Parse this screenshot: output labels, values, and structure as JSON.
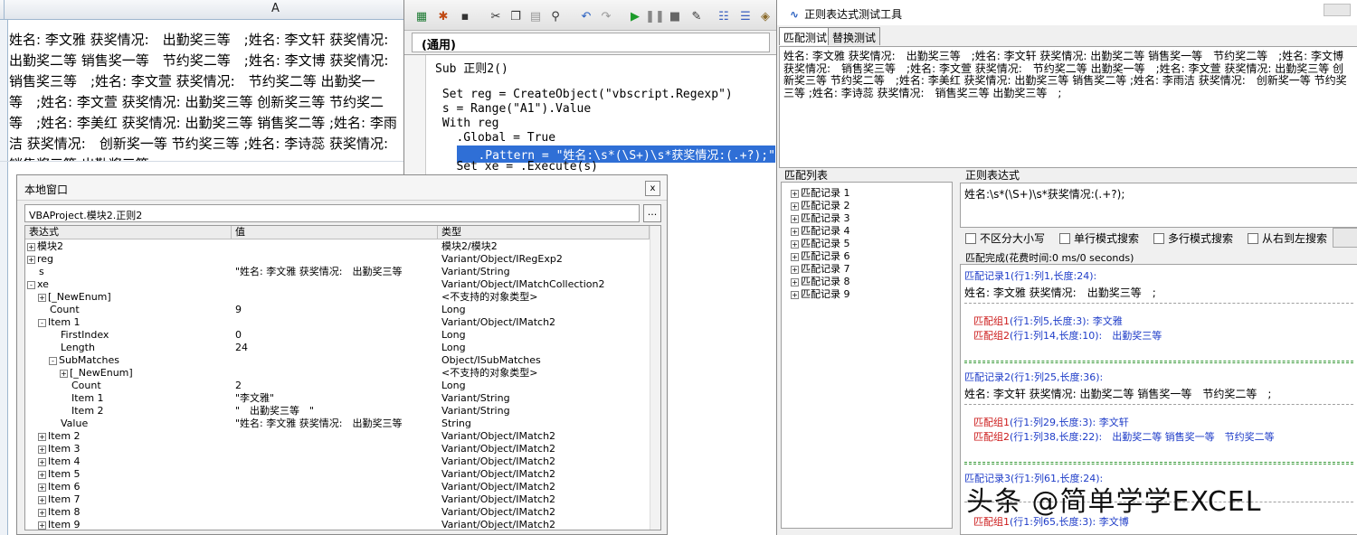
{
  "excel": {
    "column_header": "A",
    "cell_A1": "姓名: 李文雅 获奖情况:　出勤奖三等　;姓名: 李文轩 获奖情况: 出勤奖二等 销售奖一等　节约奖二等　;姓名: 李文博 获奖情况:　销售奖三等　;姓名: 李文萱 获奖情况:　节约奖二等 出勤奖一等　;姓名: 李文萱 获奖情况: 出勤奖三等 创新奖三等 节约奖二等　;姓名: 李美红 获奖情况: 出勤奖三等 销售奖二等 ;姓名: 李雨洁 获奖情况:　创新奖一等 节约奖三等 ;姓名: 李诗蕊 获奖情况:　销售奖三等 出勤奖三等　;"
  },
  "vbe": {
    "module_combo": "(通用)",
    "code": [
      "Sub 正则2()",
      "",
      " Set reg = CreateObject(\"vbscript.Regexp\")",
      " s = Range(\"A1\").Value",
      " With reg",
      "   .Global = True",
      "   .Pattern = \"姓名:\\s*(\\S+)\\s*获奖情况:(.+?);\"",
      "   Set xe = .Execute(s)"
    ]
  },
  "locals": {
    "title": "本地窗口",
    "close": "x",
    "path": "VBAProject.模块2.正则2",
    "dots": "...",
    "headers": [
      "表达式",
      "值",
      "类型"
    ],
    "rows": [
      {
        "indent": 0,
        "pm": "+",
        "expr": "模块2",
        "value": "",
        "type": "模块2/模块2"
      },
      {
        "indent": 0,
        "pm": "+",
        "expr": "reg",
        "value": "",
        "type": "Variant/Object/IRegExp2"
      },
      {
        "indent": 0,
        "pm": "",
        "expr": "s",
        "value": "\"姓名: 李文雅 获奖情况:　出勤奖三等",
        "type": "Variant/String"
      },
      {
        "indent": 0,
        "pm": "-",
        "expr": "xe",
        "value": "",
        "type": "Variant/Object/IMatchCollection2"
      },
      {
        "indent": 1,
        "pm": "+",
        "expr": "[_NewEnum]",
        "value": "",
        "type": "<不支持的对象类型>"
      },
      {
        "indent": 1,
        "pm": "",
        "expr": "Count",
        "value": "9",
        "type": "Long"
      },
      {
        "indent": 1,
        "pm": "-",
        "expr": "Item 1",
        "value": "",
        "type": "Variant/Object/IMatch2"
      },
      {
        "indent": 2,
        "pm": "",
        "expr": "FirstIndex",
        "value": "0",
        "type": "Long"
      },
      {
        "indent": 2,
        "pm": "",
        "expr": "Length",
        "value": "24",
        "type": "Long"
      },
      {
        "indent": 2,
        "pm": "-",
        "expr": "SubMatches",
        "value": "",
        "type": "Object/ISubMatches"
      },
      {
        "indent": 3,
        "pm": "+",
        "expr": "[_NewEnum]",
        "value": "",
        "type": "<不支持的对象类型>"
      },
      {
        "indent": 3,
        "pm": "",
        "expr": "Count",
        "value": "2",
        "type": "Long"
      },
      {
        "indent": 3,
        "pm": "",
        "expr": "Item 1",
        "value": "\"李文雅\"",
        "type": "Variant/String"
      },
      {
        "indent": 3,
        "pm": "",
        "expr": "Item 2",
        "value": "\"　出勤奖三等　\"",
        "type": "Variant/String"
      },
      {
        "indent": 2,
        "pm": "",
        "expr": "Value",
        "value": "\"姓名: 李文雅 获奖情况:　出勤奖三等",
        "type": "String"
      },
      {
        "indent": 1,
        "pm": "+",
        "expr": "Item 2",
        "value": "",
        "type": "Variant/Object/IMatch2"
      },
      {
        "indent": 1,
        "pm": "+",
        "expr": "Item 3",
        "value": "",
        "type": "Variant/Object/IMatch2"
      },
      {
        "indent": 1,
        "pm": "+",
        "expr": "Item 4",
        "value": "",
        "type": "Variant/Object/IMatch2"
      },
      {
        "indent": 1,
        "pm": "+",
        "expr": "Item 5",
        "value": "",
        "type": "Variant/Object/IMatch2"
      },
      {
        "indent": 1,
        "pm": "+",
        "expr": "Item 6",
        "value": "",
        "type": "Variant/Object/IMatch2"
      },
      {
        "indent": 1,
        "pm": "+",
        "expr": "Item 7",
        "value": "",
        "type": "Variant/Object/IMatch2"
      },
      {
        "indent": 1,
        "pm": "+",
        "expr": "Item 8",
        "value": "",
        "type": "Variant/Object/IMatch2"
      },
      {
        "indent": 1,
        "pm": "+",
        "expr": "Item 9",
        "value": "",
        "type": "Variant/Object/IMatch2"
      }
    ]
  },
  "regex_tool": {
    "title": "正则表达式测试工具",
    "tabs": [
      "匹配测试",
      "替换测试"
    ],
    "input_text": "姓名: 李文雅 获奖情况:　出勤奖三等　;姓名: 李文轩 获奖情况: 出勤奖二等 销售奖一等　节约奖二等　;姓名: 李文博 获奖情况:　销售奖三等　;姓名: 李文萱 获奖情况:　节约奖二等 出勤奖一等　;姓名: 李文萱 获奖情况: 出勤奖三等 创新奖三等 节约奖二等　;姓名: 李美红 获奖情况: 出勤奖三等 销售奖二等 ;姓名: 李雨洁 获奖情况:　创新奖一等 节约奖三等 ;姓名: 李诗蕊 获奖情况:　销售奖三等 出勤奖三等　;",
    "match_list_label": "匹配列表",
    "match_items": [
      "匹配记录 1",
      "匹配记录 2",
      "匹配记录 3",
      "匹配记录 4",
      "匹配记录 5",
      "匹配记录 6",
      "匹配记录 7",
      "匹配记录 8",
      "匹配记录 9"
    ],
    "pattern_label": "正则表达式",
    "pattern": "姓名:\\s*(\\S+)\\s*获奖情况:(.+?);",
    "options": [
      "不区分大小写",
      "单行模式搜索",
      "多行模式搜索",
      "从右到左搜索"
    ],
    "status": "匹配完成(花费时间:0 ms/0 seconds)",
    "results": {
      "r1_head": "匹配记录1(行1:列1,长度:24):",
      "r1_text": "姓名: 李文雅 获奖情况:　出勤奖三等　;",
      "r1_g1_label": "匹配组1",
      "r1_g1_info": "(行1:列5,长度:3): 李文雅",
      "r1_g2_label": "匹配组2",
      "r1_g2_info": "(行1:列14,长度:10):　出勤奖三等",
      "r2_head": "匹配记录2(行1:列25,长度:36):",
      "r2_text": "姓名: 李文轩 获奖情况: 出勤奖二等 销售奖一等　节约奖二等　;",
      "r2_g1_label": "匹配组1",
      "r2_g1_info": "(行1:列29,长度:3): 李文轩",
      "r2_g2_label": "匹配组2",
      "r2_g2_info": "(行1:列38,长度:22):　出勤奖二等 销售奖一等　节约奖二等",
      "r3_head": "匹配记录3(行1:列61,长度:24):",
      "r3_g1_label": "匹配组1",
      "r3_g1_info": "(行1:列65,长度:3): 李文博"
    }
  },
  "watermark": "头条 @简单学学EXCEL",
  "colors": {
    "highlight": "#2f6fd6",
    "match_blue": "#1e3cc8",
    "group_red": "#cc1a1a"
  }
}
